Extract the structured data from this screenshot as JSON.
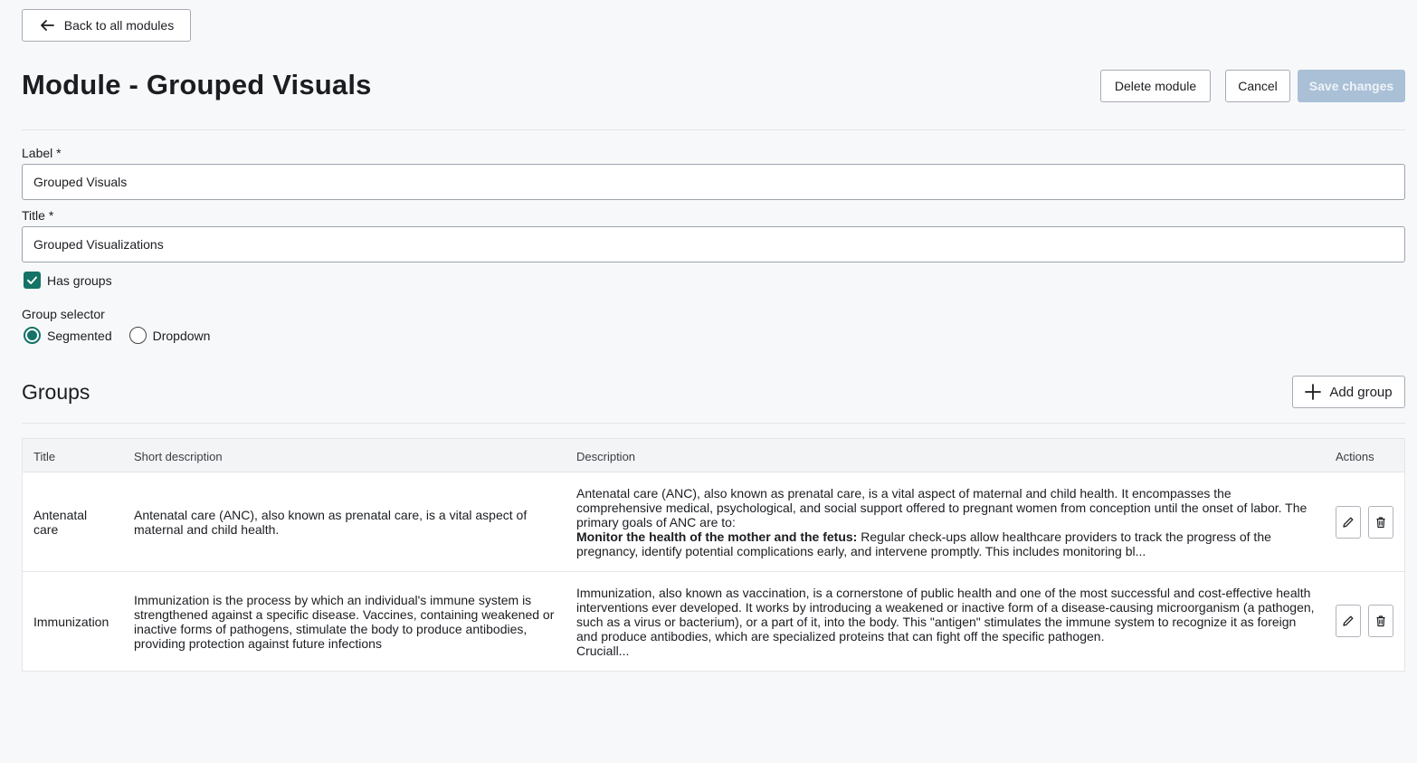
{
  "header": {
    "back_label": "Back to all modules",
    "title": "Module - Grouped Visuals",
    "delete_label": "Delete module",
    "cancel_label": "Cancel",
    "save_label": "Save changes"
  },
  "form": {
    "label_field": {
      "label": "Label *",
      "value": "Grouped Visuals"
    },
    "title_field": {
      "label": "Title *",
      "value": "Grouped Visualizations"
    },
    "has_groups": {
      "label": "Has groups",
      "checked": true
    },
    "group_selector": {
      "label": "Group selector",
      "options": [
        {
          "label": "Segmented",
          "selected": true
        },
        {
          "label": "Dropdown",
          "selected": false
        }
      ]
    }
  },
  "groups": {
    "title": "Groups",
    "add_label": "Add group",
    "columns": {
      "title": "Title",
      "short_description": "Short description",
      "description": "Description",
      "actions": "Actions"
    },
    "rows": [
      {
        "title": "Antenatal care",
        "short_description": "Antenatal care (ANC), also known as prenatal care, is a vital aspect of maternal and child health.",
        "description_intro": "Antenatal care (ANC), also known as prenatal care, is a vital aspect of maternal and child health. It encompasses the comprehensive medical, psychological, and social support offered to pregnant women from conception until the onset of labor. The primary goals of ANC are to:",
        "description_bold": "Monitor the health of the mother and the fetus:",
        "description_rest": " Regular check-ups allow healthcare providers to track the progress of the pregnancy, identify potential complications early, and intervene promptly. This includes monitoring bl..."
      },
      {
        "title": "Immunization",
        "short_description": "Immunization is the process by which an individual's immune system is strengthened against a specific disease. Vaccines, containing weakened or inactive forms of pathogens, stimulate the body to produce antibodies, providing protection against future infections",
        "description_intro": "Immunization, also known as vaccination, is a cornerstone of public health and one of the most successful and cost-effective health interventions ever developed. It works by introducing a weakened or inactive form of a disease-causing microorganism (a pathogen, such as a virus or bacterium), or a part of it, into the body. This \"antigen\" stimulates the immune system to recognize it as foreign and produce antibodies, which are specialized proteins that can fight off the specific pathogen.",
        "description_tail": "Cruciall..."
      }
    ]
  },
  "colors": {
    "accent": "#147266",
    "save_disabled": "#a9c0d6",
    "background": "#f7f8fa"
  }
}
